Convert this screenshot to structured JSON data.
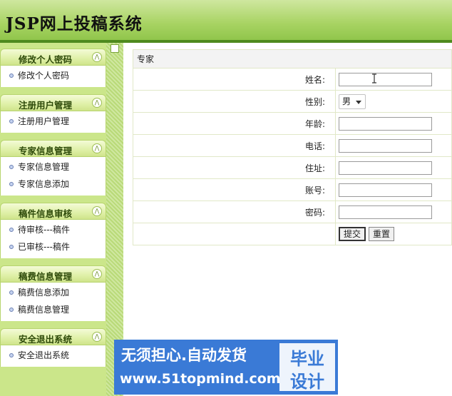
{
  "header": {
    "title": "JSP网上投稿系统"
  },
  "sidebar": {
    "groups": [
      {
        "title": "修改个人密码",
        "items": [
          "修改个人密码"
        ]
      },
      {
        "title": "注册用户管理",
        "items": [
          "注册用户管理"
        ]
      },
      {
        "title": "专家信息管理",
        "items": [
          "专家信息管理",
          "专家信息添加"
        ]
      },
      {
        "title": "稿件信息审核",
        "items": [
          "待审核---稿件",
          "已审核---稿件"
        ]
      },
      {
        "title": "稿费信息管理",
        "items": [
          "稿费信息添加",
          "稿费信息管理"
        ]
      },
      {
        "title": "安全退出系统",
        "items": [
          "安全退出系统"
        ]
      }
    ],
    "collapse_glyph": "⋀"
  },
  "form": {
    "caption": "专家",
    "fields": {
      "name_label": "姓名:",
      "gender_label": "性别:",
      "gender_value": "男",
      "age_label": "年龄:",
      "phone_label": "电话:",
      "address_label": "住址:",
      "account_label": "账号:",
      "password_label": "密码:"
    },
    "submit_label": "提交",
    "reset_label": "重置"
  },
  "watermark": {
    "slogan": "无须担心.自动发货",
    "url": "www.51topmind.com",
    "badge_line1": "毕业",
    "badge_line2": "设计"
  },
  "colors": {
    "header_green": "#a8d363",
    "header_bar": "#4e8a1e",
    "sidebar_bg": "#cbe68a",
    "watermark_blue": "#3a7ad6"
  }
}
